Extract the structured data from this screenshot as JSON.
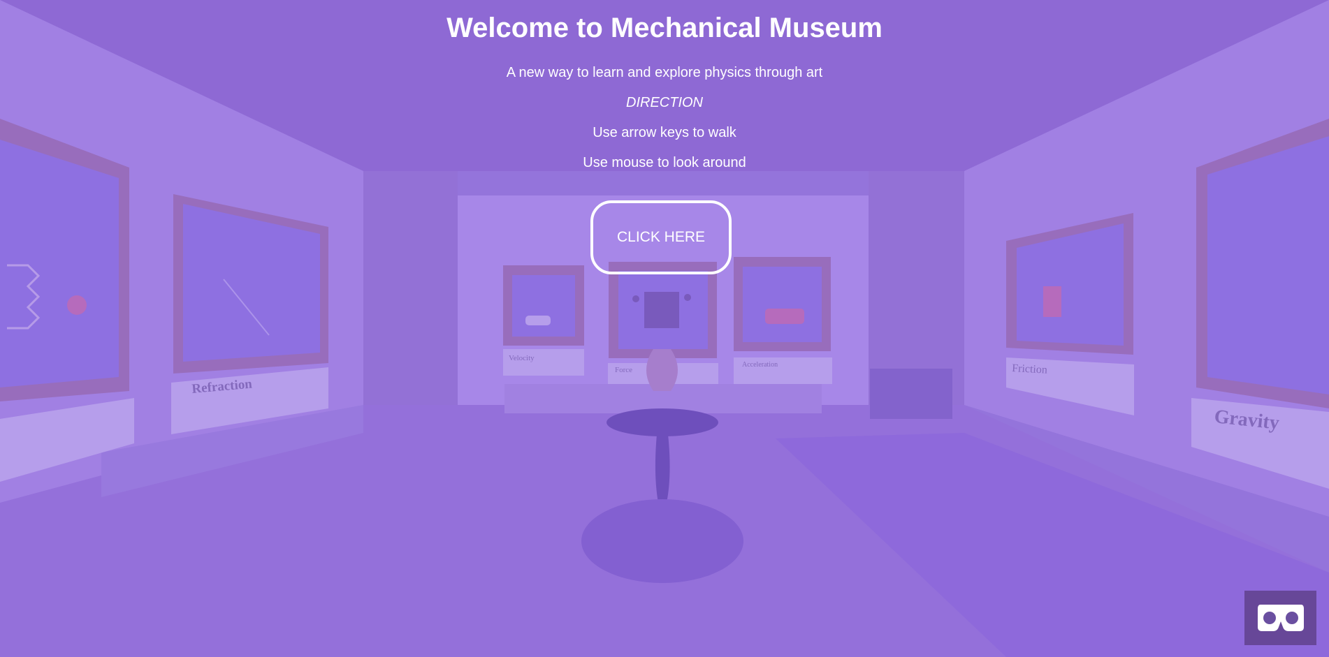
{
  "intro": {
    "title": "Welcome to Mechanical Museum",
    "subtitle": "A new way to learn and explore physics through art",
    "direction_label": "DIRECTION",
    "instruction_walk": "Use arrow keys to walk",
    "instruction_look": "Use mouse to look around",
    "cta_label": "CLICK HERE"
  },
  "exhibits": {
    "refraction": "Refraction",
    "velocity": "Velocity",
    "force": "Force",
    "acceleration": "Acceleration",
    "friction": "Friction",
    "gravity": "Gravity"
  },
  "vr_button": {
    "icon": "vr-headset-icon"
  }
}
